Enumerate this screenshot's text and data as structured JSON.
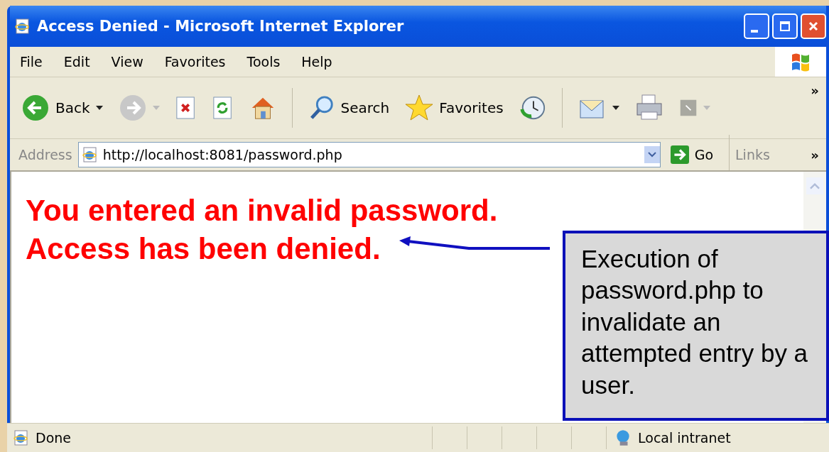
{
  "window": {
    "title": "Access Denied - Microsoft Internet Explorer"
  },
  "menu": [
    "File",
    "Edit",
    "View",
    "Favorites",
    "Tools",
    "Help"
  ],
  "toolbar": [
    {
      "kind": "back",
      "label": "Back",
      "dropdown": true
    },
    {
      "kind": "forward",
      "dropdown": true
    },
    {
      "kind": "stop"
    },
    {
      "kind": "refresh"
    },
    {
      "kind": "home"
    },
    {
      "kind": "search",
      "label": "Search"
    },
    {
      "kind": "favorites",
      "label": "Favorites"
    },
    {
      "kind": "history"
    },
    {
      "kind": "mail",
      "dropdown": true
    },
    {
      "kind": "print"
    },
    {
      "kind": "edit",
      "dropdown": true
    }
  ],
  "toolbar_more": "»",
  "address": {
    "label": "Address",
    "value": "http://localhost:8081/password.php",
    "go": "Go",
    "links": "Links",
    "more": "»"
  },
  "content": [
    "You entered an invalid password.",
    "Access has been denied."
  ],
  "callout": "Execution of password.php to invalidate an attempted entry by a user.",
  "status_bar": {
    "text": "Done",
    "zone": "Local intranet"
  }
}
